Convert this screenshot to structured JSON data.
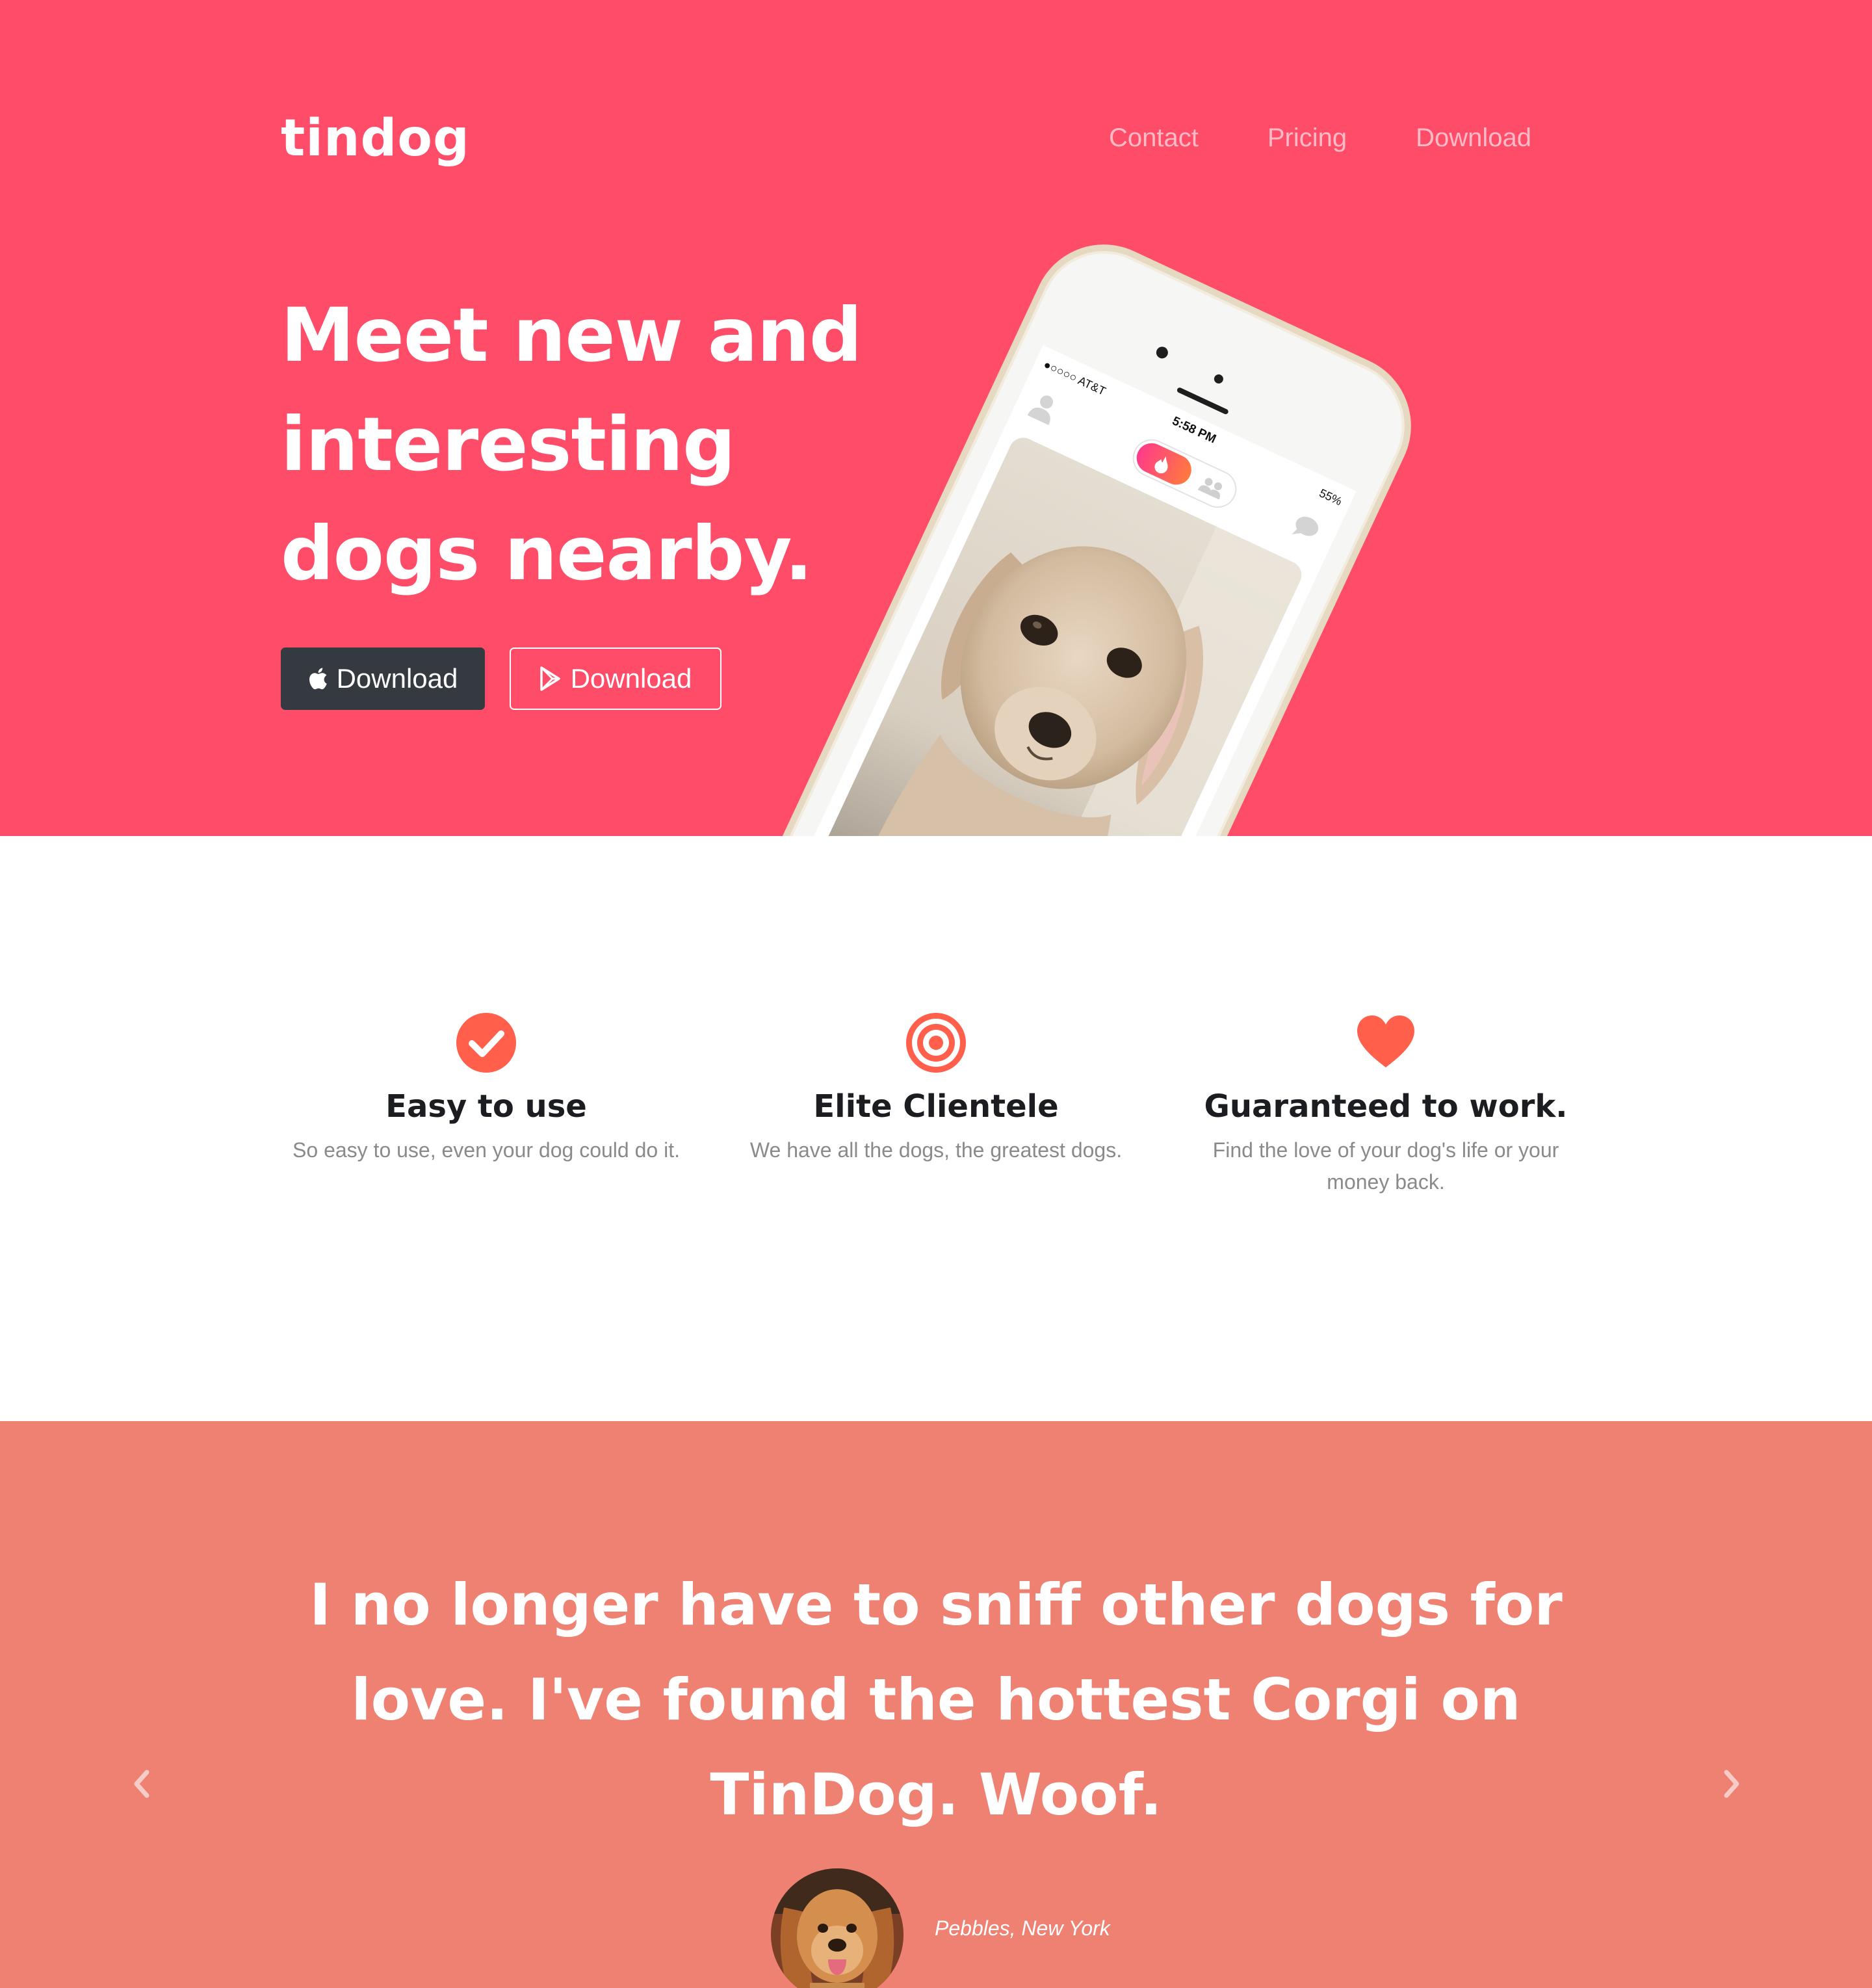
{
  "brand": {
    "name": "tindog"
  },
  "nav": {
    "items": [
      {
        "label": "Contact"
      },
      {
        "label": "Pricing"
      },
      {
        "label": "Download"
      }
    ]
  },
  "hero": {
    "headline_lines": [
      "Meet new and",
      "interesting",
      "dogs nearby."
    ],
    "buttons": [
      {
        "label": "Download",
        "icon": "apple-icon"
      },
      {
        "label": "Download",
        "icon": "google-play-icon"
      }
    ]
  },
  "phone": {
    "status_carrier": "●○○○○ AT&T",
    "status_time": "5:58 PM",
    "status_battery": "55%"
  },
  "features": [
    {
      "icon": "check-circle-icon",
      "title": "Easy to use",
      "text": "So easy to use, even your dog could do it."
    },
    {
      "icon": "bullseye-icon",
      "title": "Elite Clientele",
      "text": "We have all the dogs, the greatest dogs."
    },
    {
      "icon": "heart-icon",
      "title": "Guaranteed to work.",
      "text": "Find the love of your dog's life or your money back."
    }
  ],
  "testimonial": {
    "quote": "I no longer have to sniff other dogs for love. I've found the hottest Corgi on TinDog. Woof.",
    "author": "Pebbles, New York"
  },
  "colors": {
    "hero_bg": "#ff4c68",
    "testimonial_bg": "#ef8172",
    "accent": "#ff5f4b",
    "dark_button": "#343a40"
  }
}
